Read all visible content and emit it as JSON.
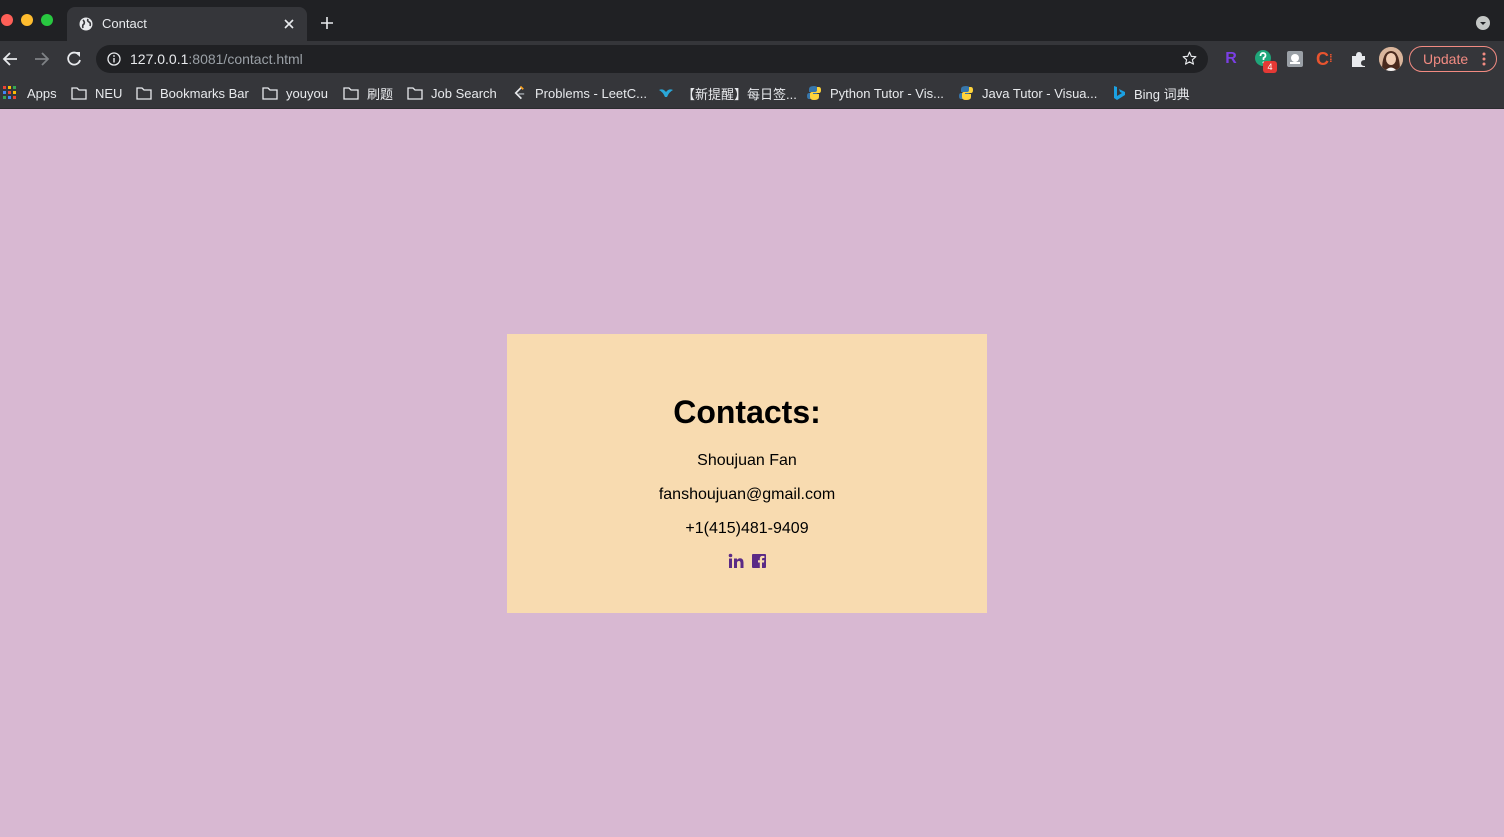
{
  "browser": {
    "tab_title": "Contact",
    "url_host": "127.0.0.1",
    "url_rest": ":8081/contact.html",
    "update_label": "Update",
    "extension_badge": "4",
    "extension_r_label": "R",
    "extension_c_label": "C"
  },
  "bookmarks": {
    "items": [
      {
        "label": "Apps",
        "icon": "apps-grid-icon"
      },
      {
        "label": "NEU",
        "icon": "folder-icon"
      },
      {
        "label": "Bookmarks Bar",
        "icon": "folder-icon"
      },
      {
        "label": "youyou",
        "icon": "folder-icon"
      },
      {
        "label": "刷题",
        "icon": "folder-icon"
      },
      {
        "label": "Job Search",
        "icon": "folder-icon"
      },
      {
        "label": "Problems - LeetC...",
        "icon": "leetcode-icon"
      },
      {
        "label": "【新提醒】每日签...",
        "icon": "bird-icon"
      },
      {
        "label": "Python Tutor - Vis...",
        "icon": "python-icon"
      },
      {
        "label": "Java Tutor - Visua...",
        "icon": "python-icon"
      },
      {
        "label": "Bing 词典",
        "icon": "bing-icon"
      }
    ]
  },
  "contact": {
    "heading": "Contacts:",
    "name": "Shoujuan Fan",
    "email": "fanshoujuan@gmail.com",
    "phone": "+1(415)481-9409",
    "social": [
      "linkedin-icon",
      "facebook-icon"
    ]
  },
  "colors": {
    "page_background": "#d8b8d2",
    "card_background": "#f8dbb0",
    "social_icon": "#5b2a86"
  }
}
